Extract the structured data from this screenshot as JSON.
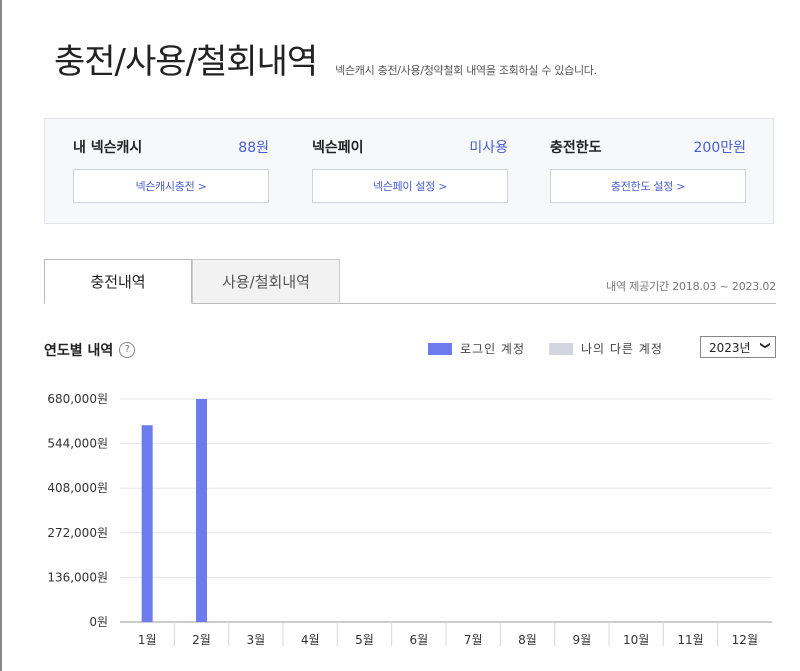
{
  "header": {
    "title": "충전/사용/철회내역",
    "subtitle": "넥슨캐시 충전/사용/청약철회 내역을 조회하실 수 있습니다."
  },
  "summary": {
    "items": [
      {
        "label": "내 넥슨캐시",
        "value": "88원",
        "button": "넥슨캐시충전 >"
      },
      {
        "label": "넥슨페이",
        "value": "미사용",
        "button": "넥슨페이 설정 >"
      },
      {
        "label": "충전한도",
        "value": "200만원",
        "button": "충전한도 설정 >"
      }
    ]
  },
  "tabs": {
    "active": "충전내역",
    "inactive": "사용/철회내역",
    "period": "내역 제공기간 2018.03 ~ 2023.02"
  },
  "chart_section": {
    "title": "연도별 내역",
    "help": "?",
    "legend": [
      {
        "label": "로그인 계정",
        "color": "#6c7cec"
      },
      {
        "label": "나의 다른 계정",
        "color": "#d3d5e0"
      }
    ],
    "year": "2023년"
  },
  "chart_data": {
    "type": "bar",
    "categories": [
      "1월",
      "2월",
      "3월",
      "4월",
      "5월",
      "6월",
      "7월",
      "8월",
      "9월",
      "10월",
      "11월",
      "12월"
    ],
    "series": [
      {
        "name": "로그인 계정",
        "values": [
          600000,
          680000,
          0,
          0,
          0,
          0,
          0,
          0,
          0,
          0,
          0,
          0
        ],
        "color": "#6c7cec"
      },
      {
        "name": "나의 다른 계정",
        "values": [
          0,
          0,
          0,
          0,
          0,
          0,
          0,
          0,
          0,
          0,
          0,
          0
        ],
        "color": "#d3d5e0"
      }
    ],
    "ylim": [
      0,
      680000
    ],
    "yticks": [
      0,
      136000,
      272000,
      408000,
      544000,
      680000
    ],
    "ytick_labels": [
      "0원",
      "136,000원",
      "272,000원",
      "408,000원",
      "544,000원",
      "680,000원"
    ],
    "grid": true,
    "title": "",
    "xlabel": "",
    "ylabel": ""
  }
}
